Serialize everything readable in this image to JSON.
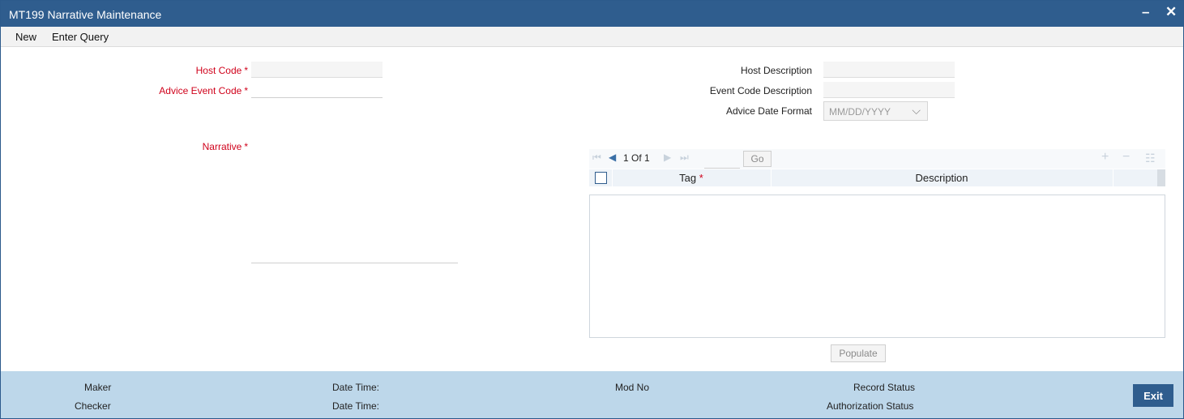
{
  "window": {
    "title": "MT199 Narrative Maintenance",
    "minimize": "–",
    "close": "✕"
  },
  "menu": {
    "new": "New",
    "enter_query": "Enter Query"
  },
  "form": {
    "host_code": {
      "label": "Host Code",
      "required": "*",
      "value": ""
    },
    "advice_event_code": {
      "label": "Advice Event Code",
      "required": "*",
      "value": ""
    },
    "narrative": {
      "label": "Narrative",
      "required": "*",
      "value": ""
    },
    "host_description": {
      "label": "Host Description",
      "value": ""
    },
    "event_code_description": {
      "label": "Event Code Description",
      "value": ""
    },
    "advice_date_format": {
      "label": "Advice Date Format",
      "value": "MM/DD/YYYY"
    }
  },
  "grid": {
    "pager_text": "1 Of 1",
    "go_label": "Go",
    "columns": {
      "tag": "Tag",
      "tag_required": "*",
      "description": "Description"
    },
    "rows": []
  },
  "populate_label": "Populate",
  "footer": {
    "maker": "Maker",
    "checker": "Checker",
    "date_time_1": "Date Time:",
    "date_time_2": "Date Time:",
    "mod_no": "Mod No",
    "record_status": "Record Status",
    "authorization_status": "Authorization Status",
    "exit_label": "Exit"
  },
  "colors": {
    "titlebar": "#2f5d8e",
    "required": "#d0021b",
    "footer": "#bdd7ea"
  }
}
